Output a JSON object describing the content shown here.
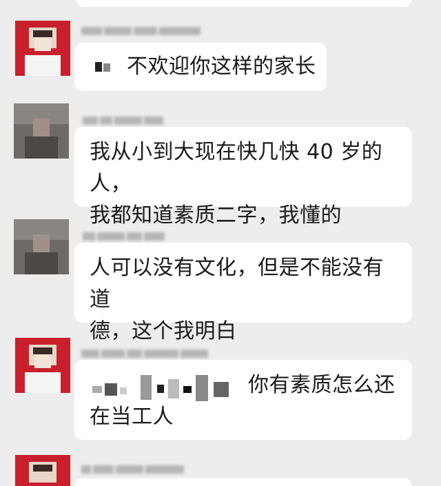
{
  "messages": [
    {
      "sender_type": "red-avatar",
      "text": "不欢迎你这样的家长"
    },
    {
      "sender_type": "gray-avatar",
      "line1": "我从小到大现在快几快 40 岁的人，",
      "line2": "我都知道素质二字，我懂的"
    },
    {
      "sender_type": "gray-avatar",
      "line1": "人可以没有文化，但是不能没有道",
      "line2": "德，这个我明白"
    },
    {
      "sender_type": "red-avatar",
      "line1": "你有素质怎么还",
      "line2": "在当工人"
    }
  ],
  "colors": {
    "background": "#ededed",
    "bubble": "#ffffff",
    "avatar_red": "#c8202c",
    "avatar_gray": "#6e6a66"
  }
}
